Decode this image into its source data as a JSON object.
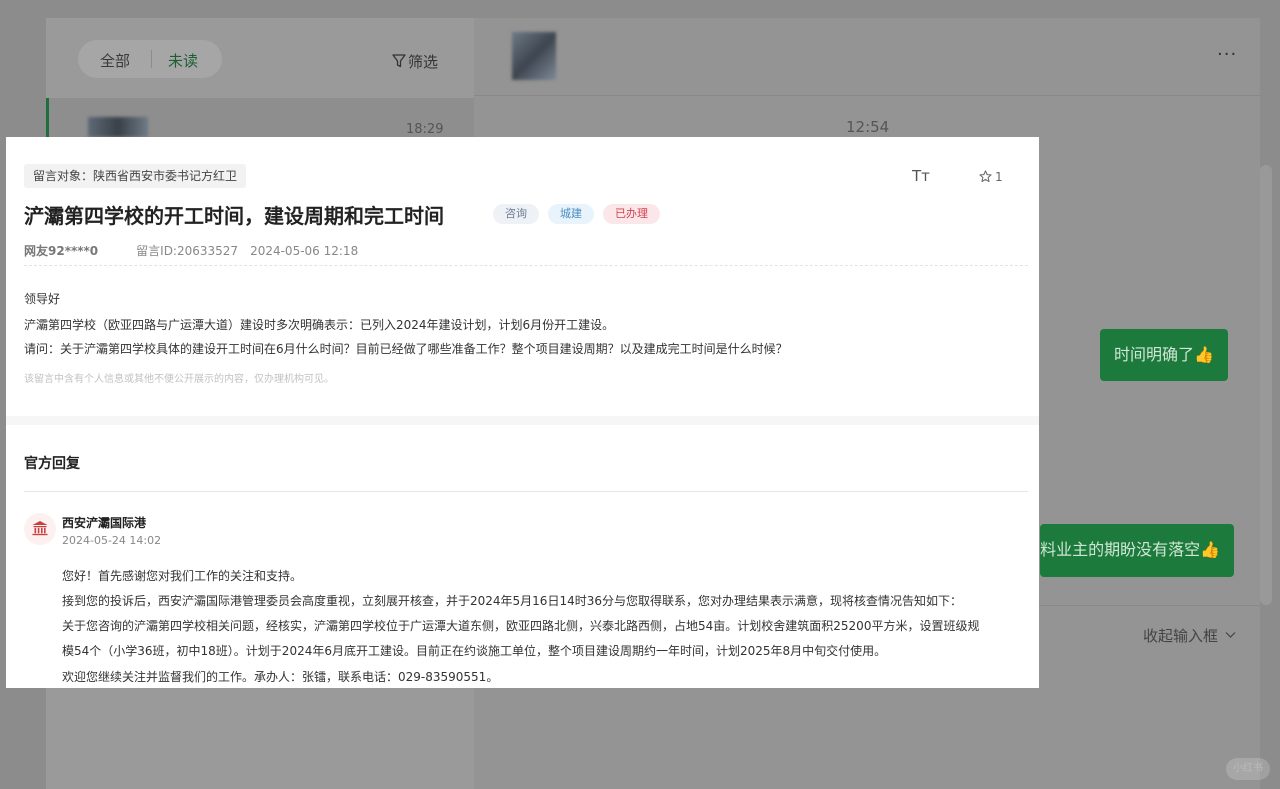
{
  "background": {
    "tabs": {
      "all": "全部",
      "unread": "未读"
    },
    "filter_label": "筛选",
    "more_menu": "···",
    "conversation_time": "18:29",
    "chat_time": "12:54",
    "bubbles": [
      "时间明确了👍",
      "料业主的期盼没有落空👍"
    ],
    "collapse_input": "收起输入框",
    "watermark": "小红书"
  },
  "message": {
    "target": "留言对象：陕西省西安市委书记方红卫",
    "font_toggle": "Tт",
    "star_count": "1",
    "title": "浐灞第四学校的开工时间，建设周期和完工时间",
    "tags": [
      "咨询",
      "城建",
      "已办理"
    ],
    "user": "网友92****0",
    "message_id": "留言ID:20633527",
    "date": "2024-05-06 12:18",
    "body": [
      "领导好",
      "浐灞第四学校（欧亚四路与广运潭大道）建设时多次明确表示：已列入2024年建设计划，计划6月份开工建设。",
      "请问：关于浐灞第四学校具体的建设开工时间在6月什么时间？目前已经做了哪些准备工作？整个项目建设周期？以及建成完工时间是什么时候？"
    ],
    "privacy_note": "该留言中含有个人信息或其他不便公开展示的内容，仅办理机构可见。"
  },
  "reply": {
    "heading": "官方回复",
    "org": "西安浐灞国际港",
    "date": "2024-05-24 14:02",
    "lines": [
      "您好！首先感谢您对我们工作的关注和支持。",
      "接到您的投诉后，西安浐灞国际港管理委员会高度重视，立刻展开核查，并于2024年5月16日14时36分与您取得联系，您对办理结果表示满意，现将核查情况告知如下：",
      "关于您咨询的浐灞第四学校相关问题，经核实，浐灞第四学校位于广运潭大道东侧，欧亚四路北侧，兴泰北路西侧，占地54亩。计划校舍建筑面积25200平方米，设置班级规",
      "模54个（小学36班，初中18班）。计划于2024年6月底开工建设。目前正在约谈施工单位，整个项目建设周期约一年时间，计划2025年8月中旬交付使用。",
      "欢迎您继续关注并监督我们的工作。承办人：张镭，联系电话：029-83590551。"
    ]
  },
  "colors": {
    "accent_green": "#1c7a3c",
    "tag_done": "#d0434f",
    "tag_city": "#4a8cc0"
  }
}
